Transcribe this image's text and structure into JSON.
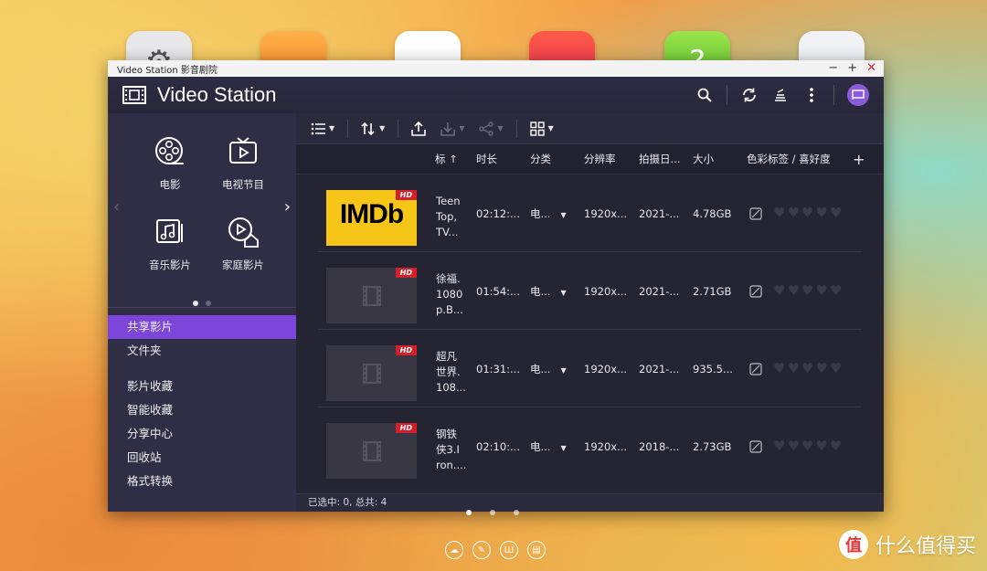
{
  "window": {
    "title": "Video Station 影音剧院",
    "controls": [
      "−",
      "+",
      "✕"
    ]
  },
  "app": {
    "name": "Video Station"
  },
  "sidebar": {
    "nav": [
      {
        "label": "电影",
        "icon": "film-reel-icon"
      },
      {
        "label": "电视节目",
        "icon": "tv-show-icon"
      },
      {
        "label": "音乐影片",
        "icon": "music-video-icon"
      },
      {
        "label": "家庭影片",
        "icon": "home-video-icon"
      }
    ],
    "menu": [
      "共享影片",
      "文件夹",
      "影片收藏",
      "智能收藏",
      "分享中心",
      "回收站",
      "格式转换"
    ],
    "active_menu": "共享影片"
  },
  "columns": {
    "title": "标",
    "duration": "时长",
    "category": "分类",
    "resolution": "分辨率",
    "date": "拍摄日...",
    "size": "大小",
    "tags": "色彩标签 / 喜好度",
    "add": "+"
  },
  "rows": [
    {
      "title_lines": [
        "Teen",
        "Top,",
        "TV..."
      ],
      "thumb": "IMDb",
      "hd": "HD",
      "duration": "02:12:...",
      "category": "电...",
      "resolution": "1920x...",
      "date": "2021-...",
      "size": "4.78GB"
    },
    {
      "title_lines": [
        "徐福.",
        "1080",
        "p.B..."
      ],
      "thumb": "",
      "hd": "HD",
      "duration": "01:54:...",
      "category": "电...",
      "resolution": "1920x...",
      "date": "2021-...",
      "size": "2.71GB"
    },
    {
      "title_lines": [
        "超凡",
        "世界.",
        "108..."
      ],
      "thumb": "",
      "hd": "HD",
      "duration": "01:31:...",
      "category": "电...",
      "resolution": "1920x...",
      "date": "2021-...",
      "size": "935.5..."
    },
    {
      "title_lines": [
        "钢铁",
        "侠3.I",
        "ron...."
      ],
      "thumb": "",
      "hd": "HD",
      "duration": "02:10:...",
      "category": "电...",
      "resolution": "1920x...",
      "date": "2018-...",
      "size": "2.73GB"
    }
  ],
  "status": {
    "text": "已选中: 0, 总共: 4"
  },
  "watermark": {
    "logo": "值",
    "text": "什么值得买"
  },
  "colors": {
    "accent": "#7b46d9",
    "hd_badge": "#d41f2a",
    "imdb": "#f5c518"
  }
}
